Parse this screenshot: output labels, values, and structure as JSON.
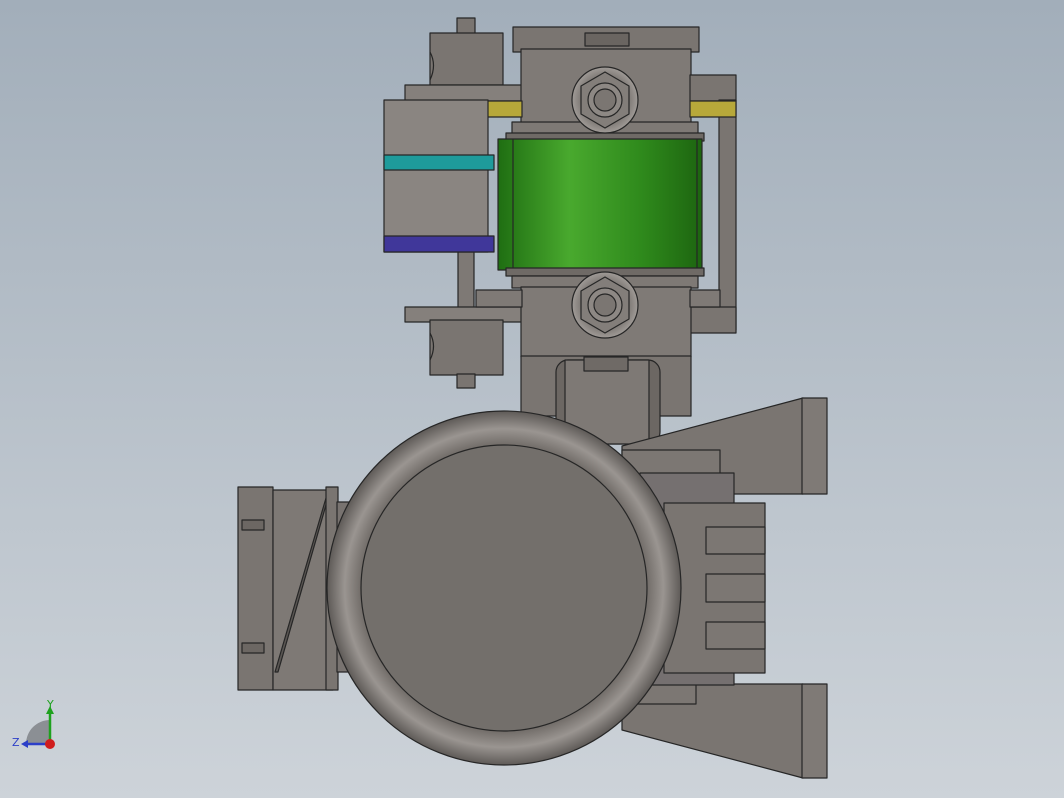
{
  "viewport": {
    "background_top": "#a2aeba",
    "background_bottom": "#cdd3d9"
  },
  "colors": {
    "metal": "#7a7571",
    "metal_light": "#8e8985",
    "metal_dark": "#5e5a57",
    "outline": "#262626",
    "coil_green": "#2f8a1c",
    "coil_green_light": "#43a52a",
    "yellow_band": "#b7a83a",
    "teal_band": "#1e9b9b",
    "purple_band": "#40379a"
  },
  "triad": {
    "y_label": "Y",
    "z_label": "Z",
    "y_color": "#1ea11e",
    "z_color": "#2c3fc8",
    "x_color": "#d01d1d"
  }
}
